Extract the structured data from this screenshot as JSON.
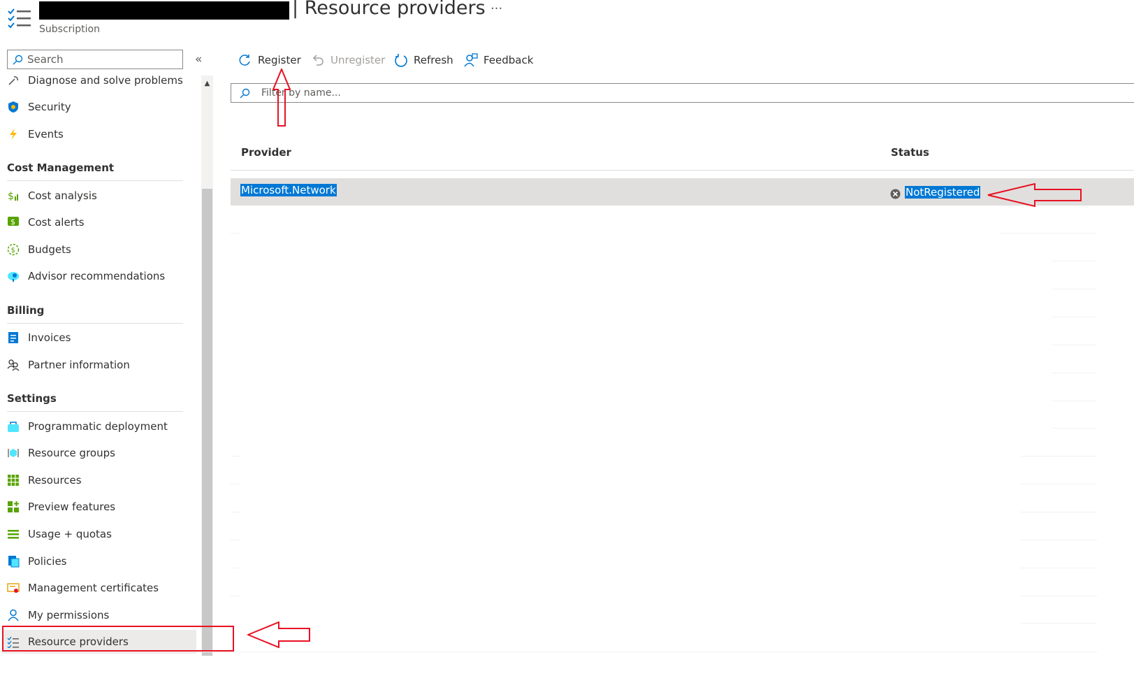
{
  "header": {
    "title": "Resource providers",
    "subtitle": "Subscription",
    "more_label": "···"
  },
  "sidebar": {
    "search_placeholder": "Search",
    "collapse_label": "«",
    "items_top": [
      {
        "label": "Diagnose and solve problems",
        "icon": "wrench-icon"
      },
      {
        "label": "Security",
        "icon": "shield-icon"
      },
      {
        "label": "Events",
        "icon": "lightning-icon"
      }
    ],
    "sections": [
      {
        "title": "Cost Management",
        "items": [
          {
            "label": "Cost analysis",
            "icon": "cost-analysis-icon"
          },
          {
            "label": "Cost alerts",
            "icon": "cost-alerts-icon"
          },
          {
            "label": "Budgets",
            "icon": "budgets-icon"
          },
          {
            "label": "Advisor recommendations",
            "icon": "advisor-icon"
          }
        ]
      },
      {
        "title": "Billing",
        "items": [
          {
            "label": "Invoices",
            "icon": "invoices-icon"
          },
          {
            "label": "Partner information",
            "icon": "partner-icon"
          }
        ]
      },
      {
        "title": "Settings",
        "items": [
          {
            "label": "Programmatic deployment",
            "icon": "deployment-icon"
          },
          {
            "label": "Resource groups",
            "icon": "resource-groups-icon"
          },
          {
            "label": "Resources",
            "icon": "resources-grid-icon"
          },
          {
            "label": "Preview features",
            "icon": "preview-features-icon"
          },
          {
            "label": "Usage + quotas",
            "icon": "usage-quotas-icon"
          },
          {
            "label": "Policies",
            "icon": "policies-icon"
          },
          {
            "label": "Management certificates",
            "icon": "certificates-icon"
          },
          {
            "label": "My permissions",
            "icon": "person-icon"
          },
          {
            "label": "Resource providers",
            "icon": "checklist-icon",
            "selected": true
          }
        ]
      }
    ]
  },
  "toolbar": {
    "register": "Register",
    "unregister": "Unregister",
    "refresh": "Refresh",
    "feedback": "Feedback"
  },
  "filter": {
    "placeholder": "Filter by name..."
  },
  "table": {
    "columns": [
      "Provider",
      "Status"
    ],
    "selected_row": {
      "provider": "Microsoft.Network",
      "status": "NotRegistered"
    }
  },
  "colors": {
    "accent": "#0078d4",
    "annotation": "#e81123",
    "selection_bg": "#e1dfdd"
  }
}
